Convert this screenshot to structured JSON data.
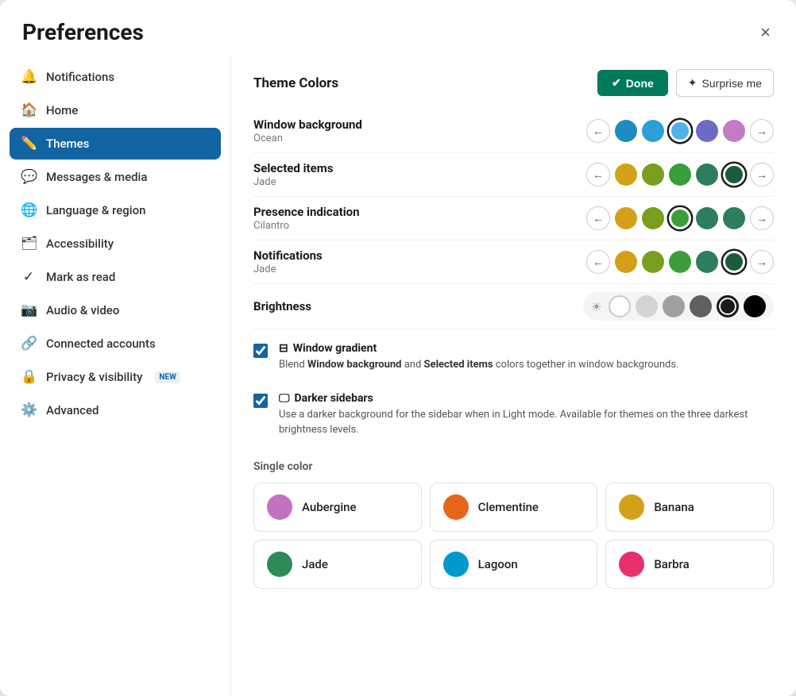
{
  "modal": {
    "title": "Preferences",
    "close_label": "×"
  },
  "sidebar": {
    "items": [
      {
        "id": "notifications",
        "label": "Notifications",
        "icon": "🔔",
        "active": false
      },
      {
        "id": "home",
        "label": "Home",
        "icon": "🏠",
        "active": false
      },
      {
        "id": "themes",
        "label": "Themes",
        "icon": "✏️",
        "active": true
      },
      {
        "id": "messages",
        "label": "Messages & media",
        "icon": "💬",
        "active": false
      },
      {
        "id": "language",
        "label": "Language & region",
        "icon": "🌐",
        "active": false
      },
      {
        "id": "accessibility",
        "label": "Accessibility",
        "icon": "🗂",
        "active": false
      },
      {
        "id": "markasread",
        "label": "Mark as read",
        "icon": "✓",
        "active": false
      },
      {
        "id": "audiovideo",
        "label": "Audio & video",
        "icon": "📷",
        "active": false
      },
      {
        "id": "connected",
        "label": "Connected accounts",
        "icon": "🔗",
        "active": false
      },
      {
        "id": "privacy",
        "label": "Privacy & visibility",
        "icon": "🔒",
        "active": false,
        "badge": "NEW"
      },
      {
        "id": "advanced",
        "label": "Advanced",
        "icon": "⚙️",
        "active": false
      }
    ]
  },
  "main": {
    "section_title": "Theme Colors",
    "btn_done": "Done",
    "btn_surprise": "Surprise me",
    "color_rows": [
      {
        "id": "window_bg",
        "name": "Window background",
        "sub": "Ocean",
        "swatches": [
          {
            "color": "#1e8bc3",
            "selected": false
          },
          {
            "color": "#2d9fd8",
            "selected": false
          },
          {
            "color": "#4fb3e8",
            "selected": true,
            "ring": true
          },
          {
            "color": "#6b6bc7",
            "selected": false
          },
          {
            "color": "#c37bc3",
            "selected": false
          }
        ]
      },
      {
        "id": "selected_items",
        "name": "Selected items",
        "sub": "Jade",
        "swatches": [
          {
            "color": "#d4a017",
            "selected": false
          },
          {
            "color": "#7a9e1e",
            "selected": false
          },
          {
            "color": "#3a9e3a",
            "selected": false
          },
          {
            "color": "#2e7d5c",
            "selected": false
          },
          {
            "color": "#1a5c3a",
            "selected": true,
            "ring": true
          }
        ]
      },
      {
        "id": "presence",
        "name": "Presence indication",
        "sub": "Cilantro",
        "swatches": [
          {
            "color": "#d4a017",
            "selected": false
          },
          {
            "color": "#7a9e1e",
            "selected": false
          },
          {
            "color": "#3a9e3a",
            "selected": true,
            "ring": true
          },
          {
            "color": "#2e7d5c",
            "selected": false
          },
          {
            "color": "#2e7d5c",
            "selected": false
          }
        ]
      },
      {
        "id": "notifications_row",
        "name": "Notifications",
        "sub": "Jade",
        "swatches": [
          {
            "color": "#d4a017",
            "selected": false
          },
          {
            "color": "#7a9e1e",
            "selected": false
          },
          {
            "color": "#3a9e3a",
            "selected": false
          },
          {
            "color": "#2e7d5c",
            "selected": false
          },
          {
            "color": "#1a5c3a",
            "selected": true,
            "ring": true
          }
        ]
      }
    ],
    "brightness": {
      "label": "Brightness",
      "swatches": [
        {
          "color": "#ffffff",
          "selected": false
        },
        {
          "color": "#d4d4d4",
          "selected": false
        },
        {
          "color": "#a0a0a0",
          "selected": false
        },
        {
          "color": "#606060",
          "selected": false
        },
        {
          "color": "#1a1a1a",
          "selected": true
        },
        {
          "color": "#000000",
          "selected": false
        }
      ]
    },
    "checkboxes": [
      {
        "id": "window_gradient",
        "checked": true,
        "icon": "⊟",
        "title": "Window gradient",
        "desc_parts": [
          {
            "text": "Blend ",
            "bold": false
          },
          {
            "text": "Window background",
            "bold": true
          },
          {
            "text": " and ",
            "bold": false
          },
          {
            "text": "Selected items",
            "bold": true
          },
          {
            "text": " colors together in window backgrounds.",
            "bold": false
          }
        ]
      },
      {
        "id": "darker_sidebars",
        "checked": true,
        "icon": "🖵",
        "title": "Darker sidebars",
        "desc": "Use a darker background for the sidebar when in Light mode. Available for themes on the three darkest brightness levels."
      }
    ],
    "single_color_label": "Single color",
    "color_cards": [
      {
        "id": "aubergine",
        "label": "Aubergine",
        "color": "#c270c2"
      },
      {
        "id": "clementine",
        "label": "Clementine",
        "color": "#e8651a"
      },
      {
        "id": "banana",
        "label": "Banana",
        "color": "#d4a017"
      },
      {
        "id": "jade",
        "label": "Jade",
        "color": "#2e8b57"
      },
      {
        "id": "lagoon",
        "label": "Lagoon",
        "color": "#0099cc"
      },
      {
        "id": "barbra",
        "label": "Barbra",
        "color": "#e8306a"
      }
    ]
  }
}
